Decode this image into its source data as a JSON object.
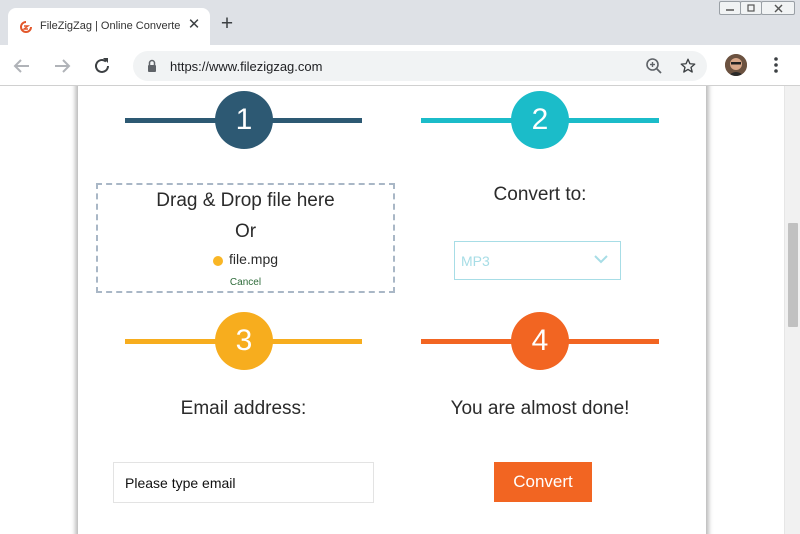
{
  "browser": {
    "tab_title": "FileZigZag | Online Converter, Compress",
    "url": "https://www.filezigzag.com",
    "colors": {
      "favicon": "#e2572b"
    }
  },
  "steps": [
    {
      "number": "1",
      "color": "#2d5973"
    },
    {
      "number": "2",
      "color": "#1bbcc9"
    },
    {
      "number": "3",
      "color": "#f7ad1e"
    },
    {
      "number": "4",
      "color": "#f26522"
    }
  ],
  "upload": {
    "title": "Drag & Drop file here",
    "or_text": "Or",
    "file_name": "file.mpg",
    "cancel_label": "Cancel"
  },
  "convert_to": {
    "label": "Convert to:",
    "selected": "MP3"
  },
  "email": {
    "label": "Email address:",
    "placeholder": "Please type email"
  },
  "finish": {
    "label": "You are almost done!",
    "button_label": "Convert"
  }
}
